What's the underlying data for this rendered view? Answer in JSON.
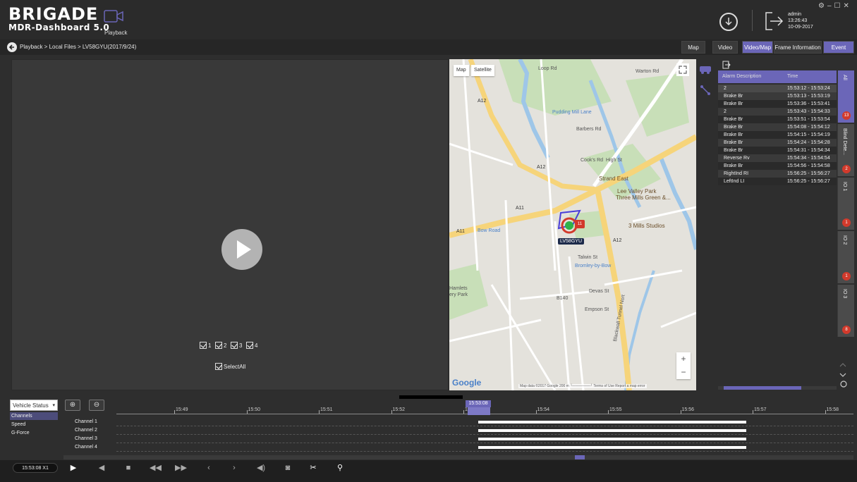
{
  "app": {
    "brand": "BRIGADE",
    "subtitle": "MDR-Dashboard 5.0",
    "module_label": "Playback",
    "user": "admin",
    "time": "13:26:43",
    "date": "10-09-2017"
  },
  "breadcrumb": "Playback > Local Files > LV58GYU(2017/9/24)",
  "tabs": [
    "Map",
    "Video",
    "Video/Map",
    "Frame Information",
    "Event"
  ],
  "active_tab": "Video/Map",
  "video": {
    "channels": [
      "1",
      "2",
      "3",
      "4"
    ],
    "select_all": "SelectAll"
  },
  "map": {
    "type_buttons": [
      "Map",
      "Satellite"
    ],
    "vehicle_label": "LV58GYU",
    "marker_count": "11",
    "labels": {
      "pudding": "Pudding Mill Lane",
      "strand": "Strand East",
      "lee1": "Lee Valley Park",
      "lee2": "Three Mills Green &...",
      "mills": "3 Mills Studios",
      "bow": "Bow Road",
      "bromley": "Bromley-by-Bow",
      "hamlets": "Hamlets",
      "park": "ery Park",
      "a11a": "A11",
      "a11b": "A11",
      "a12a": "A12",
      "a12b": "A12",
      "a12c": "A12",
      "b140": "B140",
      "devas": "Devas St",
      "empson": "Empson St",
      "talwin": "Talwin St",
      "cooks": "Cook's Rd",
      "high": "High St",
      "barbers": "Barbers Rd",
      "blackwall": "Blackwall Tunnel Nort",
      "loop": "Loop Rd",
      "warton": "Warton Rd"
    },
    "google": "Google",
    "footer": "Map data ©2017 Google   200 m └───────┘   Terms of Use   Report a map error",
    "zoom_in": "+",
    "zoom_out": "−"
  },
  "events": {
    "columns": [
      "Alarm Description",
      "Time"
    ],
    "rows": [
      {
        "desc": "2",
        "time": "15:53:12 - 15:53:24"
      },
      {
        "desc": "Brake Br",
        "time": "15:53:13 - 15:53:19"
      },
      {
        "desc": "Brake Br",
        "time": "15:53:36 - 15:53:41"
      },
      {
        "desc": "2",
        "time": "15:53:43 - 15:54:33"
      },
      {
        "desc": "Brake Br",
        "time": "15:53:51 - 15:53:54"
      },
      {
        "desc": "Brake Br",
        "time": "15:54:08 - 15:54:12"
      },
      {
        "desc": "Brake Br",
        "time": "15:54:15 - 15:54:19"
      },
      {
        "desc": "Brake Br",
        "time": "15:54:24 - 15:54:28"
      },
      {
        "desc": "Brake Br",
        "time": "15:54:31 - 15:54:34"
      },
      {
        "desc": "Reverse Rv",
        "time": "15:54:34 - 15:54:54"
      },
      {
        "desc": "Brake Br",
        "time": "15:54:56 - 15:54:58"
      },
      {
        "desc": "RightInd RI",
        "time": "15:56:25 - 15:56:27"
      },
      {
        "desc": "LeftInd LI",
        "time": "15:56:25 - 15:56:27"
      }
    ],
    "side_tabs": [
      {
        "label": "All",
        "badge": "13"
      },
      {
        "label": "Blind Dete...",
        "badge": "2"
      },
      {
        "label": "IO 1",
        "badge": "1"
      },
      {
        "label": "IO 2",
        "badge": "1"
      },
      {
        "label": "IO 3",
        "badge": "8"
      }
    ]
  },
  "timeline": {
    "status_select": "Vehicle Status",
    "status_items": [
      "Channels",
      "Speed",
      "G-Force"
    ],
    "time_labels": [
      "15:49",
      "15:50",
      "15:51",
      "15:52",
      "15:53",
      "15:54",
      "15:55",
      "15:56",
      "15:57",
      "15:58"
    ],
    "cursor_time": "15:53:08",
    "channels": [
      "Channel 1",
      "Channel 2",
      "Channel 3",
      "Channel 4"
    ]
  },
  "controls": {
    "time_display": "15:53:08  X1"
  }
}
